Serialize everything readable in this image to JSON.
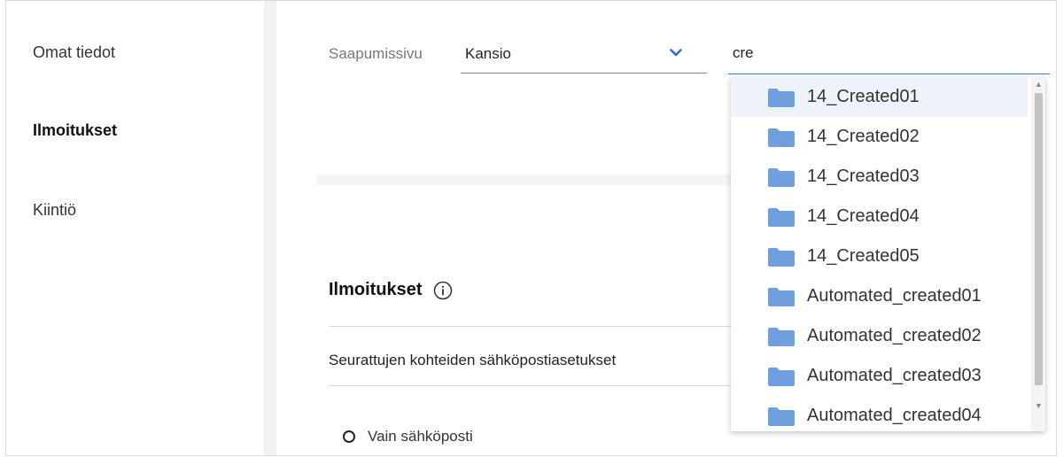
{
  "sidebar": {
    "items": [
      {
        "label": "Omat tiedot"
      },
      {
        "label": "Ilmoitukset"
      },
      {
        "label": "Kiintiö"
      }
    ]
  },
  "landing": {
    "label": "Saapumissivu",
    "select_value": "Kansio",
    "search_value": "cre"
  },
  "dropdown": {
    "items": [
      {
        "label": "14_Created01"
      },
      {
        "label": "14_Created02"
      },
      {
        "label": "14_Created03"
      },
      {
        "label": "14_Created04"
      },
      {
        "label": "14_Created05"
      },
      {
        "label": "Automated_created01"
      },
      {
        "label": "Automated_created02"
      },
      {
        "label": "Automated_created03"
      },
      {
        "label": "Automated_created04"
      }
    ]
  },
  "notifications": {
    "title": "Ilmoitukset",
    "email_settings": "Seurattujen kohteiden sähköpostiasetukset",
    "option_email_only": "Vain sähköposti"
  },
  "icons": {
    "folder": "folder-icon",
    "info": "info-icon",
    "chevron": "chevron-down-icon"
  },
  "colors": {
    "accent": "#3a78c9",
    "folder": "#6f9fdc"
  }
}
